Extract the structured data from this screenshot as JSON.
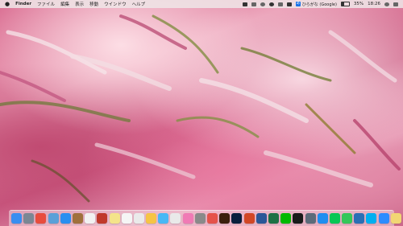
{
  "menubar": {
    "app_name": "Finder",
    "menus": [
      "ファイル",
      "編集",
      "表示",
      "移動",
      "ウインドウ",
      "ヘルプ"
    ],
    "input_method": "ひらがな (Google)",
    "input_mark": "あ",
    "battery_percent": "35%",
    "battery_level": 0.35,
    "clock": "18:26"
  },
  "dock": {
    "apps": [
      {
        "name": "finder",
        "color": "#3a8ef0"
      },
      {
        "name": "launchpad",
        "color": "#7b8794"
      },
      {
        "name": "chrome",
        "color": "#e84c3d"
      },
      {
        "name": "preview",
        "color": "#5aa0d8"
      },
      {
        "name": "safari",
        "color": "#2a8ff0"
      },
      {
        "name": "notes-brown",
        "color": "#a0703c"
      },
      {
        "name": "calendar",
        "color": "#f2f2f2"
      },
      {
        "name": "photo-booth",
        "color": "#c0392b"
      },
      {
        "name": "stickies",
        "color": "#f4e48a"
      },
      {
        "name": "reminders",
        "color": "#f5f5f5"
      },
      {
        "name": "textedit",
        "color": "#eaeaea"
      },
      {
        "name": "photos",
        "color": "#f6c445"
      },
      {
        "name": "messages",
        "color": "#48b8f5"
      },
      {
        "name": "facetime",
        "color": "#e9e9e9"
      },
      {
        "name": "itunes",
        "color": "#f07ab5"
      },
      {
        "name": "system-preferences",
        "color": "#8a8a8a"
      },
      {
        "name": "color-app",
        "color": "#e5534b"
      },
      {
        "name": "illustrator",
        "color": "#3b1f0d"
      },
      {
        "name": "photoshop",
        "color": "#0a1f3d"
      },
      {
        "name": "powerpoint",
        "color": "#d24726"
      },
      {
        "name": "word",
        "color": "#2b5797"
      },
      {
        "name": "excel",
        "color": "#1e7145"
      },
      {
        "name": "line",
        "color": "#00b900"
      },
      {
        "name": "terminal-black",
        "color": "#1a1a1a"
      },
      {
        "name": "at-app",
        "color": "#5c6b7a"
      },
      {
        "name": "app-store",
        "color": "#1e8ef0"
      },
      {
        "name": "line-green",
        "color": "#06c755"
      },
      {
        "name": "messages-green",
        "color": "#34c759"
      },
      {
        "name": "quicktime",
        "color": "#2a6fb5"
      },
      {
        "name": "skype",
        "color": "#00aff0"
      },
      {
        "name": "zoom",
        "color": "#2d8cff"
      },
      {
        "name": "folder",
        "color": "#f2d674"
      },
      {
        "name": "trash",
        "color": "#d8d8d8"
      }
    ]
  }
}
